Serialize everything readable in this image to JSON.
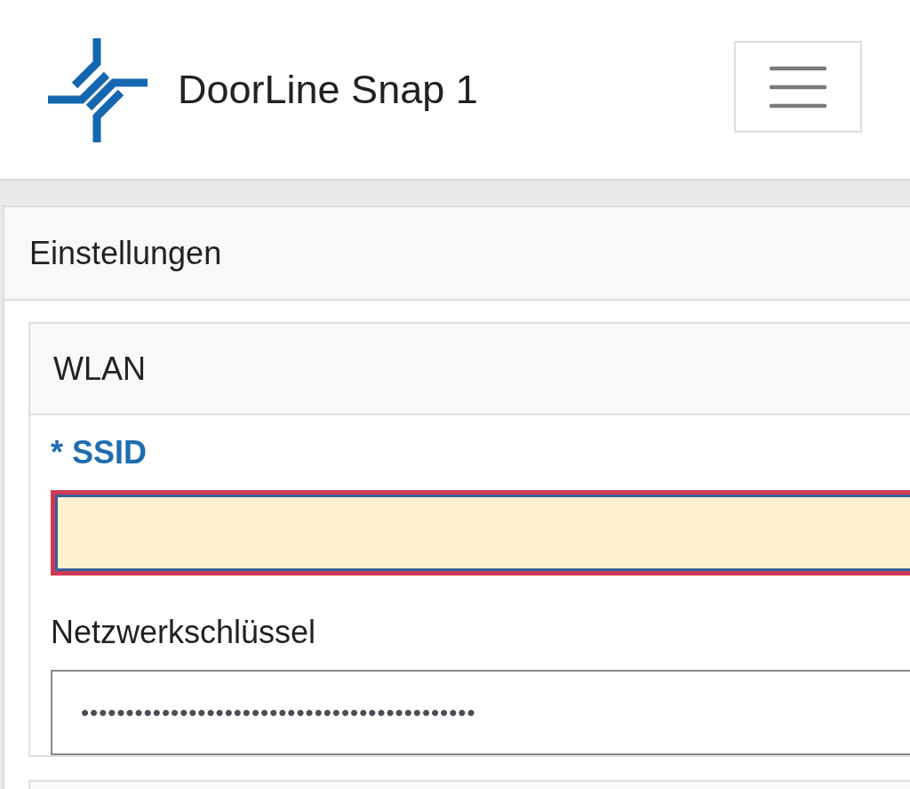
{
  "header": {
    "title": "DoorLine Snap 1"
  },
  "panel": {
    "title": "Einstellungen"
  },
  "section": {
    "title": "WLAN",
    "fields": [
      {
        "label": "SSID",
        "required_mark": "*",
        "required": true,
        "invalid": true
      },
      {
        "label": "Netzwerkschlüssel",
        "required": false,
        "invalid": false,
        "value": "••••••••••••••••••••••••••••••••••••••••••••"
      }
    ]
  }
}
